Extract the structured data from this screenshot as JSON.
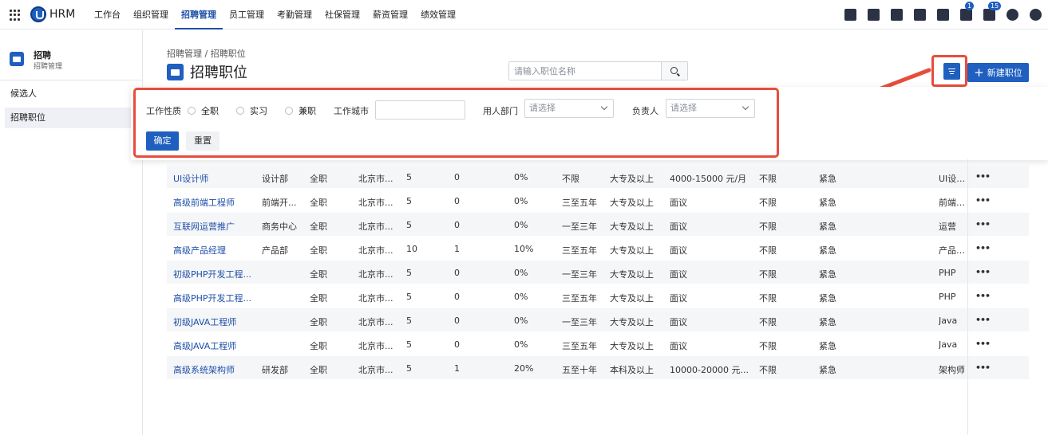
{
  "app": {
    "brand": "HRM"
  },
  "nav": [
    "工作台",
    "组织管理",
    "招聘管理",
    "员工管理",
    "考勤管理",
    "社保管理",
    "薪资管理",
    "绩效管理"
  ],
  "nav_active": 2,
  "top_icons": [
    {
      "icon": "task-icon"
    },
    {
      "icon": "user-icon"
    },
    {
      "icon": "document-icon"
    },
    {
      "icon": "phone-icon"
    },
    {
      "icon": "calendar-icon"
    },
    {
      "icon": "flag-icon",
      "badge": "1"
    },
    {
      "icon": "bell-icon",
      "badge": "15"
    },
    {
      "icon": "help-icon"
    },
    {
      "icon": "settings-icon"
    }
  ],
  "sidebar": {
    "title": "招聘",
    "subtitle": "招聘管理",
    "items": [
      {
        "label": "候选人"
      },
      {
        "label": "招聘职位"
      }
    ],
    "active": 1
  },
  "breadcrumb": "招聘管理 / 招聘职位",
  "page_title": "招聘职位",
  "search": {
    "placeholder": "请输入职位名称"
  },
  "new_button": "新建职位",
  "filter": {
    "job_type_label": "工作性质",
    "job_types": [
      "全职",
      "实习",
      "兼职"
    ],
    "city_label": "工作城市",
    "dept_label": "用人部门",
    "dept_placeholder": "请选择",
    "owner_label": "负责人",
    "owner_placeholder": "请选择",
    "confirm": "确定",
    "reset": "重置"
  },
  "rows": [
    [
      "UI设计师",
      "设计部",
      "全职",
      "北京市...",
      "5",
      "0",
      "0%",
      "不限",
      "大专及以上",
      "4000-15000 元/月",
      "不限",
      "紧急",
      "UI设计师"
    ],
    [
      "高级前端工程师",
      "前端开...",
      "全职",
      "北京市...",
      "5",
      "0",
      "0%",
      "三至五年",
      "大专及以上",
      "面议",
      "不限",
      "紧急",
      "前端开发"
    ],
    [
      "互联网运营推广",
      "商务中心",
      "全职",
      "北京市...",
      "5",
      "0",
      "0%",
      "一至三年",
      "大专及以上",
      "面议",
      "不限",
      "紧急",
      "运营"
    ],
    [
      "高级产品经理",
      "产品部",
      "全职",
      "北京市...",
      "10",
      "1",
      "10%",
      "三至五年",
      "大专及以上",
      "面议",
      "不限",
      "紧急",
      "产品经理"
    ],
    [
      "初级PHP开发工程...",
      "",
      "全职",
      "北京市...",
      "5",
      "0",
      "0%",
      "一至三年",
      "大专及以上",
      "面议",
      "不限",
      "紧急",
      "PHP"
    ],
    [
      "高级PHP开发工程...",
      "",
      "全职",
      "北京市...",
      "5",
      "0",
      "0%",
      "三至五年",
      "大专及以上",
      "面议",
      "不限",
      "紧急",
      "PHP"
    ],
    [
      "初级JAVA工程师",
      "",
      "全职",
      "北京市...",
      "5",
      "0",
      "0%",
      "一至三年",
      "大专及以上",
      "面议",
      "不限",
      "紧急",
      "Java"
    ],
    [
      "高级JAVA工程师",
      "",
      "全职",
      "北京市...",
      "5",
      "0",
      "0%",
      "三至五年",
      "大专及以上",
      "面议",
      "不限",
      "紧急",
      "Java"
    ],
    [
      "高级系统架构师",
      "研发部",
      "全职",
      "北京市...",
      "5",
      "1",
      "20%",
      "五至十年",
      "本科及以上",
      "10000-20000 元...",
      "不限",
      "紧急",
      "架构师"
    ]
  ],
  "more_label": "•••",
  "colors": {
    "primary": "#1f5fbf",
    "highlight": "#e74c3c"
  }
}
